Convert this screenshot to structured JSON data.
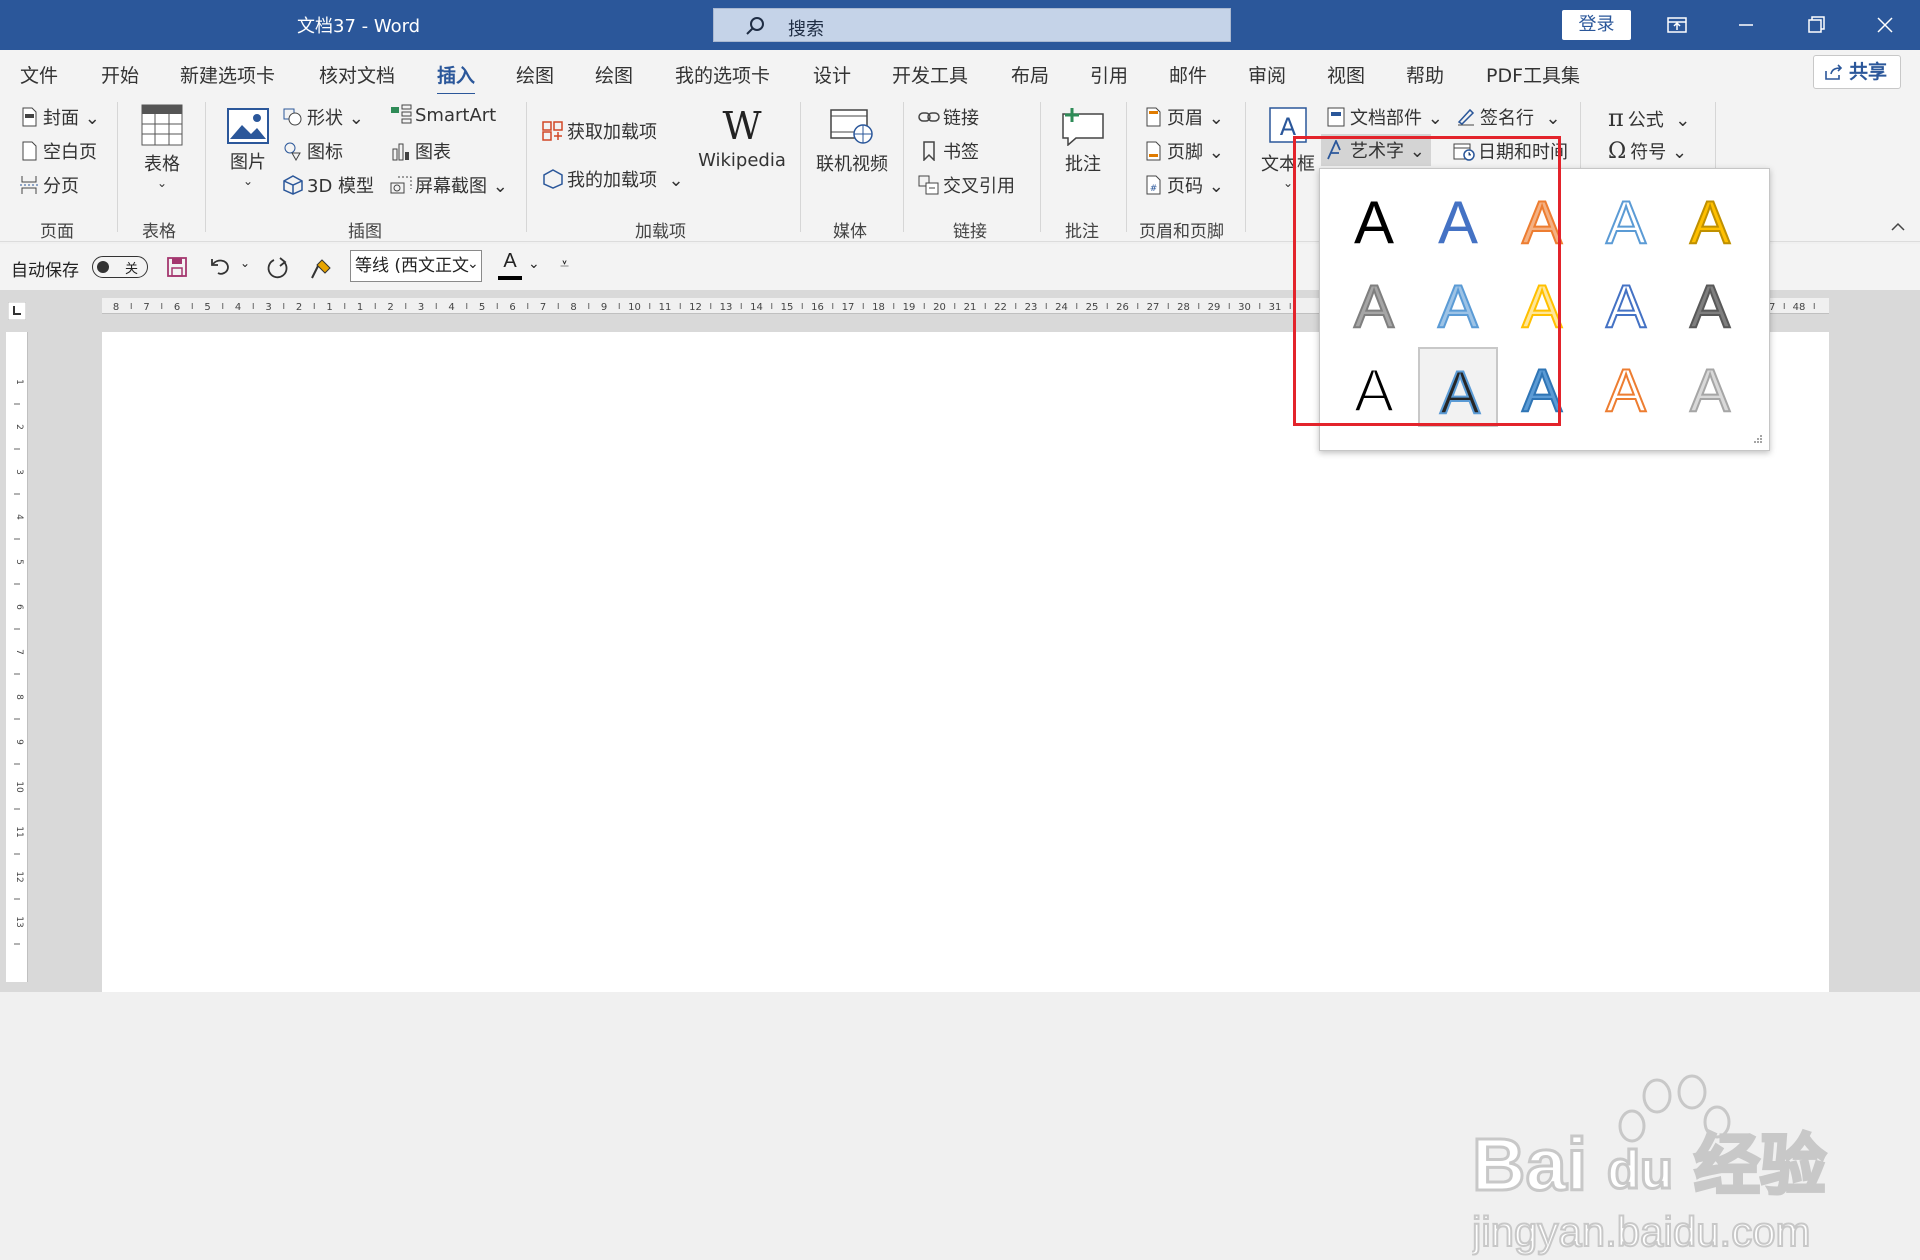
{
  "titlebar": {
    "doc_title": "文档37  -  Word",
    "search_text": "搜索",
    "login": "登录"
  },
  "menu": {
    "tabs": [
      "文件",
      "开始",
      "新建选项卡",
      "核对文档",
      "插入",
      "绘图",
      "绘图",
      "我的选项卡",
      "设计",
      "开发工具",
      "布局",
      "引用",
      "邮件",
      "审阅",
      "视图",
      "帮助",
      "PDF工具集"
    ],
    "active_index": 4,
    "share": "共享"
  },
  "ribbon": {
    "pages": {
      "cover": "封面",
      "blank": "空白页",
      "break": "分页",
      "label": "页面"
    },
    "tables": {
      "table": "表格",
      "label": "表格"
    },
    "illustrations": {
      "picture": "图片",
      "shapes": "形状",
      "icons": "图标",
      "model3d": "3D 模型",
      "smartart": "SmartArt",
      "chart": "图表",
      "screenshot": "屏幕截图",
      "label": "插图"
    },
    "addins": {
      "get": "获取加载项",
      "my": "我的加载项",
      "wikipedia": "Wikipedia",
      "label": "加载项"
    },
    "media": {
      "video": "联机视频",
      "label": "媒体"
    },
    "links": {
      "link": "链接",
      "bookmark": "书签",
      "crossref": "交叉引用",
      "label": "链接"
    },
    "comments": {
      "comment": "批注",
      "label": "批注"
    },
    "header_footer": {
      "header": "页眉",
      "footer": "页脚",
      "page_number": "页码",
      "label": "页眉和页脚"
    },
    "text": {
      "textbox": "文本框",
      "quickparts": "文档部件",
      "wordart": "艺术字",
      "signature": "签名行",
      "datetime": "日期和时间"
    },
    "symbols": {
      "equation": "公式",
      "symbol": "符号"
    }
  },
  "qat": {
    "autosave": "自动保存",
    "toggle": "关",
    "font": "等线 (西文正文"
  },
  "ruler": {
    "h_numbers": [
      "8",
      "7",
      "6",
      "5",
      "4",
      "3",
      "2",
      "1",
      "1",
      "2",
      "3",
      "4",
      "5",
      "6",
      "7",
      "8",
      "9",
      "10",
      "11",
      "12",
      "13",
      "14",
      "15",
      "16",
      "17",
      "18",
      "19",
      "20",
      "21",
      "22",
      "23",
      "24",
      "25",
      "26",
      "27",
      "28",
      "29",
      "30",
      "31",
      "47",
      "48"
    ],
    "v_numbers": [
      "1",
      "2",
      "3",
      "4",
      "5",
      "6",
      "7",
      "8",
      "9",
      "10",
      "11",
      "12",
      "13"
    ]
  },
  "wordart_gallery": {
    "glyph": "A",
    "selected_index": 11,
    "styles": [
      {
        "fill": "#000000",
        "stroke": "none"
      },
      {
        "fill": "#4472c4",
        "stroke": "none"
      },
      {
        "fill": "#f4b183",
        "stroke": "#ed7d31"
      },
      {
        "fill": "#ffffff",
        "stroke": "#5b9bd5"
      },
      {
        "fill": "#ffc000",
        "stroke": "#bf9000"
      },
      {
        "fill": "#a6a6a6",
        "stroke": "#7f7f7f"
      },
      {
        "fill": "#9dc3e6",
        "stroke": "#5b9bd5"
      },
      {
        "fill": "#ffe699",
        "stroke": "#ffc000"
      },
      {
        "fill": "#ffffff",
        "stroke": "#4472c4"
      },
      {
        "fill": "#7f7f7f",
        "stroke": "#595959"
      },
      {
        "fill": "#000000",
        "stroke": "#ffffff"
      },
      {
        "fill": "#262626",
        "stroke": "#5b9bd5"
      },
      {
        "fill": "#5b9bd5",
        "stroke": "#2f75b5"
      },
      {
        "fill": "#ffffff",
        "stroke": "#ed7d31"
      },
      {
        "fill": "#d9d9d9",
        "stroke": "#a6a6a6"
      }
    ]
  },
  "watermark": {
    "brand": "Bai",
    "brand2": "du",
    "cn": "经验",
    "url": "jingyan.baidu.com"
  },
  "colors": {
    "accent": "#2b579a",
    "highlight": "#e3232b"
  }
}
